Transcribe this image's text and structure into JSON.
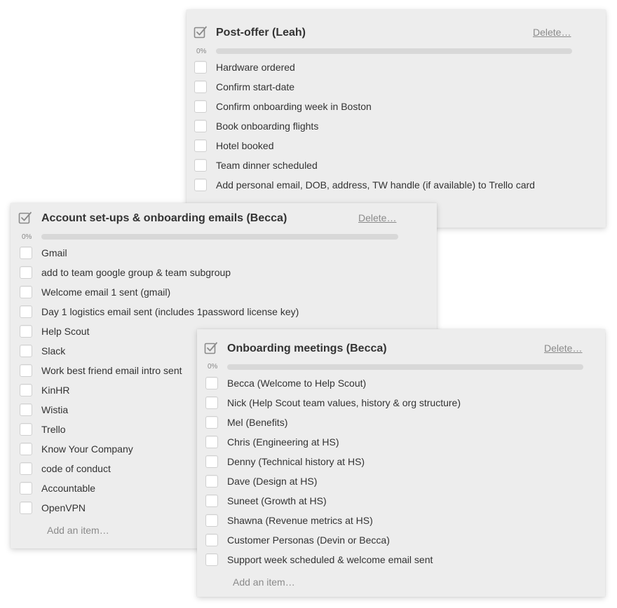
{
  "checklists": [
    {
      "title": "Post-offer (Leah)",
      "icon": "checklist-icon",
      "delete_label": "Delete…",
      "progress_label": "0%",
      "progress": 0,
      "items": [
        "Hardware ordered",
        "Confirm start-date",
        "Confirm onboarding week in Boston",
        "Book onboarding flights",
        "Hotel booked",
        "Team dinner scheduled",
        "Add personal email, DOB, address, TW handle (if available) to Trello card"
      ]
    },
    {
      "title": "Account set-ups & onboarding emails (Becca)",
      "icon": "checklist-icon",
      "delete_label": "Delete…",
      "progress_label": "0%",
      "progress": 0,
      "items": [
        "Gmail",
        "add to team google group & team subgroup",
        "Welcome email 1 sent (gmail)",
        "Day 1 logistics email sent (includes 1password license key)",
        "Help Scout",
        "Slack",
        "Work best friend email intro sent",
        "KinHR",
        "Wistia",
        "Trello",
        "Know Your Company",
        "code of conduct",
        "Accountable",
        "OpenVPN"
      ],
      "add_item_label": "Add an item…"
    },
    {
      "title": "Onboarding meetings (Becca)",
      "icon": "checklist-icon",
      "delete_label": "Delete…",
      "progress_label": "0%",
      "progress": 0,
      "items": [
        "Becca (Welcome to Help Scout)",
        "Nick (Help Scout team values, history & org structure)",
        "Mel (Benefits)",
        "Chris (Engineering at HS)",
        "Denny (Technical history at HS)",
        "Dave (Design at HS)",
        "Suneet (Growth at HS)",
        "Shawna (Revenue metrics at HS)",
        "Customer Personas (Devin or Becca)",
        "Support week scheduled & welcome email sent"
      ],
      "add_item_label": "Add an item…"
    }
  ],
  "colors": {
    "card_background": "#ededed",
    "progress_track": "#d8d8d8",
    "progress_fill": "#5ba4cf",
    "link_gray": "#8a8a8a"
  }
}
